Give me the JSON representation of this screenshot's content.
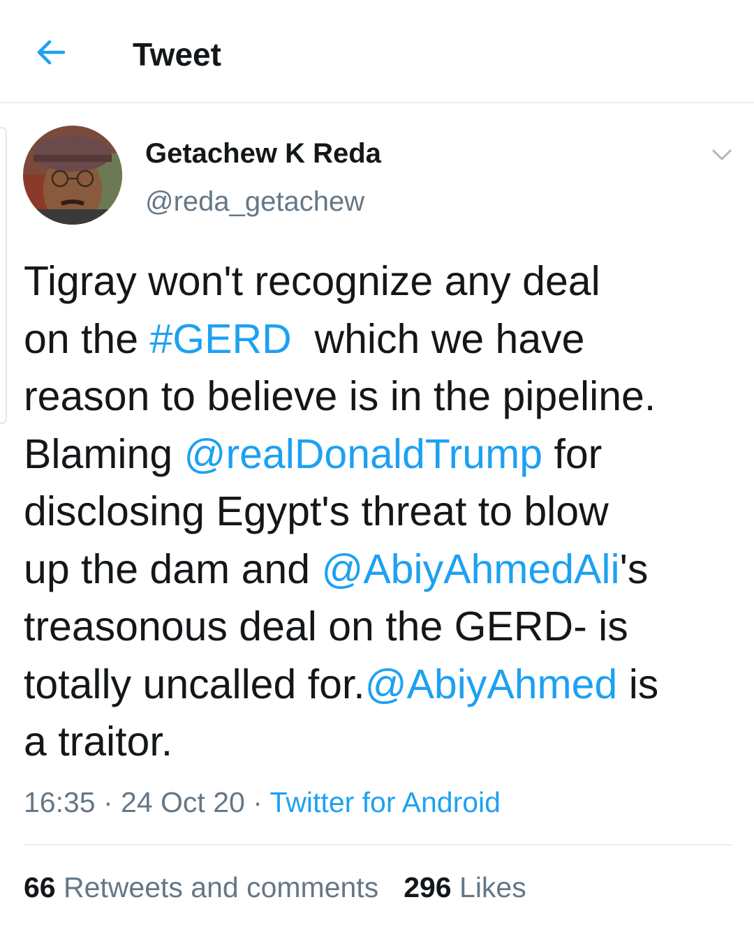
{
  "header": {
    "title": "Tweet",
    "back_icon": "arrow-left-icon",
    "accent_color": "#1da1f2"
  },
  "tweet": {
    "author": {
      "display_name": "Getachew K Reda",
      "handle": "@reda_getachew"
    },
    "text_lines": [
      [
        {
          "t": "Tigray won't recognize any deal"
        }
      ],
      [
        {
          "t": "on the "
        },
        {
          "t": "#GERD",
          "link": true
        },
        {
          "t": "  which we have"
        }
      ],
      [
        {
          "t": "reason to believe is in the pipeline."
        }
      ],
      [
        {
          "t": "Blaming "
        },
        {
          "t": "@realDonaldTrump",
          "link": true
        },
        {
          "t": " for"
        }
      ],
      [
        {
          "t": "disclosing Egypt's threat to blow"
        }
      ],
      [
        {
          "t": "up the dam and "
        },
        {
          "t": "@AbiyAhmedAli",
          "link": true
        },
        {
          "t": "'s"
        }
      ],
      [
        {
          "t": "treasonous deal on the GERD- is"
        }
      ],
      [
        {
          "t": "totally uncalled for."
        },
        {
          "t": "@AbiyAhmed",
          "link": true
        },
        {
          "t": " is"
        }
      ],
      [
        {
          "t": "a traitor."
        }
      ]
    ],
    "time": "16:35",
    "separator": " · ",
    "date": "24 Oct 20",
    "source": "Twitter for Android",
    "retweets_count": "66",
    "retweets_label": " Retweets and comments",
    "likes_count": "296",
    "likes_label": " Likes"
  }
}
